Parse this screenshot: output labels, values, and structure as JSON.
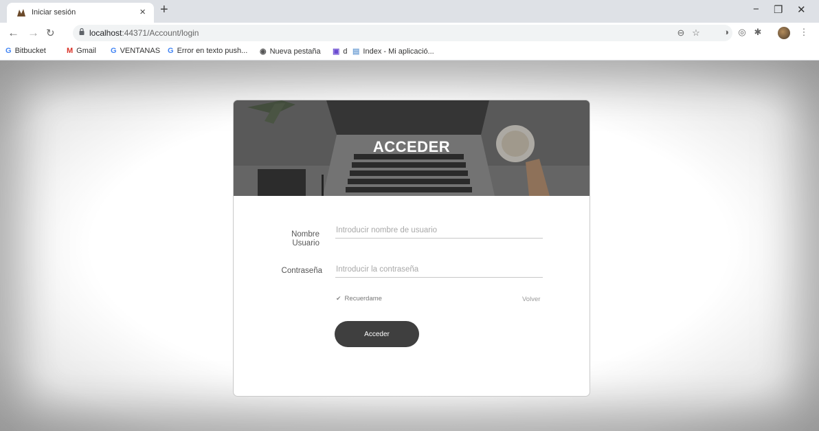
{
  "browser": {
    "tab": {
      "title": "Iniciar sesión"
    },
    "window_controls": {
      "minimize": "−",
      "maximize": "❐",
      "close": "✕"
    },
    "url": {
      "host": "localhost",
      "rest": ":44371/Account/login"
    },
    "bookmarks": [
      {
        "label": "Bitbucket",
        "icon": "G"
      },
      {
        "label": "Gmail",
        "icon": "M"
      },
      {
        "label": "VENTANAS",
        "icon": "G"
      },
      {
        "label": "Error en texto push...",
        "icon": "G"
      },
      {
        "label": "Nueva pestaña",
        "icon": "◉"
      },
      {
        "label": "d",
        "icon": "▣"
      },
      {
        "label": "Index - Mi aplicació...",
        "icon": "▤"
      }
    ]
  },
  "login": {
    "title": "ACCEDER",
    "username_label_1": "Nombre",
    "username_label_2": "Usuario",
    "username_placeholder": "Introducir nombre de usuario",
    "password_label": "Contraseña",
    "password_placeholder": "Introducir la contraseña",
    "remember_label": "Recuerdame",
    "back_label": "Volver",
    "submit_label": "Acceder"
  }
}
